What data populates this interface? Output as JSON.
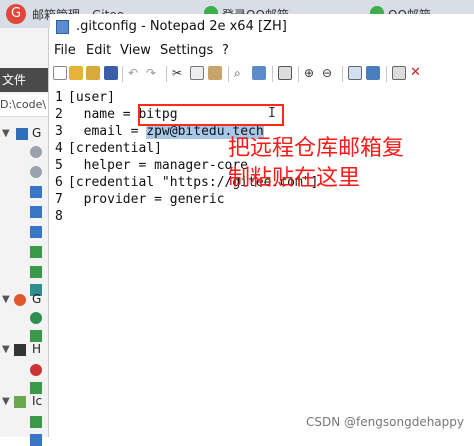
{
  "background_browser": {
    "tab1_text": "邮箱管理 - Gitee",
    "tab2_text": "登录QQ邮箱",
    "tab3_text": "QQ邮箱"
  },
  "explorer": {
    "bar_label": "文件",
    "path": "D:\\code\\",
    "tree": [
      {
        "label": "G",
        "expanded": true
      },
      {
        "label": "G",
        "expanded": true
      },
      {
        "label": "H",
        "expanded": true
      },
      {
        "label": "Ic",
        "expanded": true
      }
    ]
  },
  "window": {
    "title": ".gitconfig - Notepad 2e x64 [ZH]",
    "menu": [
      "File",
      "Edit",
      "View",
      "Settings",
      "?"
    ]
  },
  "editor": {
    "line_numbers": [
      "1",
      "2",
      "3",
      "4",
      "5",
      "6",
      "7",
      "8"
    ],
    "lines": [
      "[user]",
      "  name = bitpg",
      "  email = ",
      "[credential]",
      "  helper = manager-core",
      "[credential \"https://gitee.com\"]",
      "  provider = generic",
      ""
    ],
    "selected_email": "zpw@bitedu.tech",
    "cursor_glyph": "I"
  },
  "annotation": {
    "line1": "把远程仓库邮箱复",
    "line2": "制粘贴在这里"
  },
  "watermark": "CSDN @fengsongdehappy",
  "colors": {
    "annotation": "#ff1a1a",
    "selection": "#a8c8e8",
    "tab_bg": "#d8dde6"
  }
}
